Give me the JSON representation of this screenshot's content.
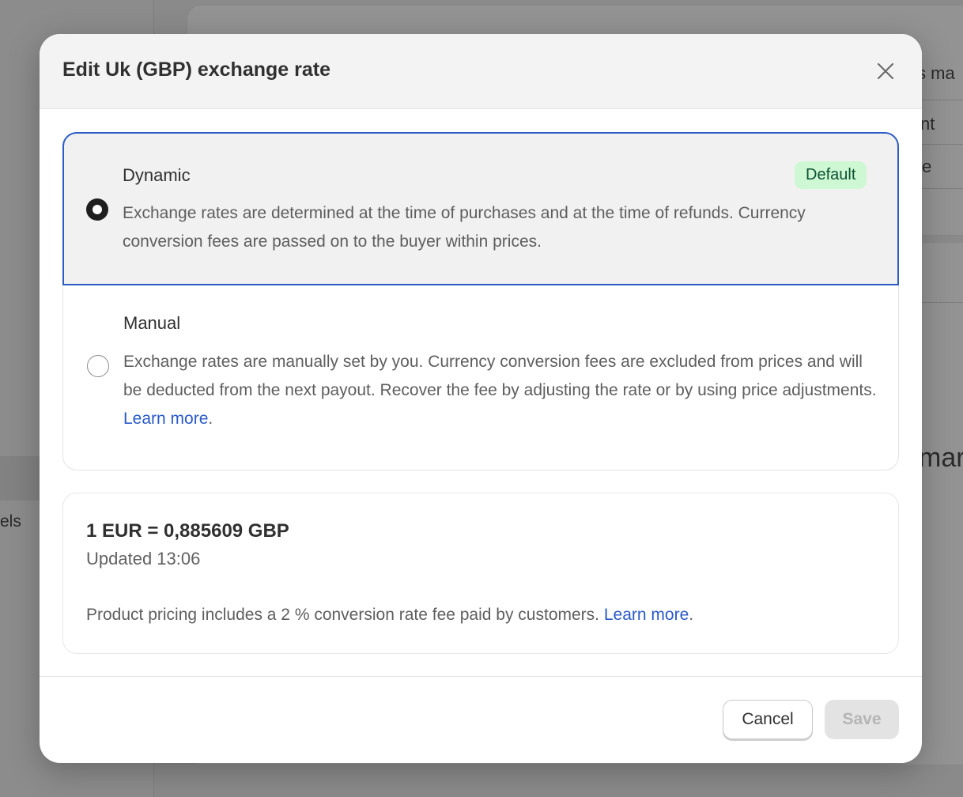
{
  "background": {
    "sidebar_fragment": "els",
    "fragments": [
      "s ma",
      "nt",
      "e",
      "mar"
    ]
  },
  "modal": {
    "title": "Edit Uk (GBP) exchange rate",
    "options": [
      {
        "label": "Dynamic",
        "badge": "Default",
        "selected": true,
        "description": "Exchange rates are determined at the time of purchases and at the time of refunds. Currency conversion fees are passed on to the buyer within prices."
      },
      {
        "label": "Manual",
        "selected": false,
        "description": "Exchange rates are manually set by you. Currency conversion fees are excluded from prices and will be deducted from the next payout. Recover the fee by adjusting the rate or by using price adjustments.",
        "link": "Learn more",
        "link_suffix": "."
      }
    ],
    "rate": {
      "value": "1 EUR = 0,885609 GBP",
      "updated": "Updated 13:06",
      "note": "Product pricing includes a 2 % conversion rate fee paid by customers.",
      "link": "Learn more",
      "link_suffix": "."
    },
    "buttons": {
      "cancel": "Cancel",
      "save": "Save"
    }
  },
  "colors": {
    "accent": "#2c5cc5",
    "link": "#2a5ac9",
    "badge_bg": "#cdf8d3",
    "badge_text": "#0c5132"
  },
  "icons": {
    "close": "close-icon"
  }
}
